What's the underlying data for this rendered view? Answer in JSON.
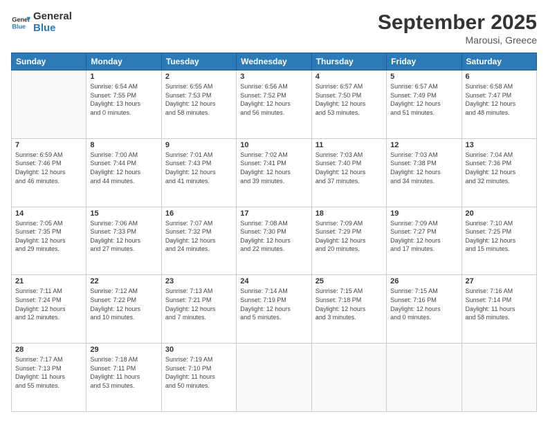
{
  "header": {
    "logo_line1": "General",
    "logo_line2": "Blue",
    "month_title": "September 2025",
    "location": "Marousi, Greece"
  },
  "weekdays": [
    "Sunday",
    "Monday",
    "Tuesday",
    "Wednesday",
    "Thursday",
    "Friday",
    "Saturday"
  ],
  "weeks": [
    [
      {
        "day": "",
        "info": ""
      },
      {
        "day": "1",
        "info": "Sunrise: 6:54 AM\nSunset: 7:55 PM\nDaylight: 13 hours\nand 0 minutes."
      },
      {
        "day": "2",
        "info": "Sunrise: 6:55 AM\nSunset: 7:53 PM\nDaylight: 12 hours\nand 58 minutes."
      },
      {
        "day": "3",
        "info": "Sunrise: 6:56 AM\nSunset: 7:52 PM\nDaylight: 12 hours\nand 56 minutes."
      },
      {
        "day": "4",
        "info": "Sunrise: 6:57 AM\nSunset: 7:50 PM\nDaylight: 12 hours\nand 53 minutes."
      },
      {
        "day": "5",
        "info": "Sunrise: 6:57 AM\nSunset: 7:49 PM\nDaylight: 12 hours\nand 51 minutes."
      },
      {
        "day": "6",
        "info": "Sunrise: 6:58 AM\nSunset: 7:47 PM\nDaylight: 12 hours\nand 48 minutes."
      }
    ],
    [
      {
        "day": "7",
        "info": "Sunrise: 6:59 AM\nSunset: 7:46 PM\nDaylight: 12 hours\nand 46 minutes."
      },
      {
        "day": "8",
        "info": "Sunrise: 7:00 AM\nSunset: 7:44 PM\nDaylight: 12 hours\nand 44 minutes."
      },
      {
        "day": "9",
        "info": "Sunrise: 7:01 AM\nSunset: 7:43 PM\nDaylight: 12 hours\nand 41 minutes."
      },
      {
        "day": "10",
        "info": "Sunrise: 7:02 AM\nSunset: 7:41 PM\nDaylight: 12 hours\nand 39 minutes."
      },
      {
        "day": "11",
        "info": "Sunrise: 7:03 AM\nSunset: 7:40 PM\nDaylight: 12 hours\nand 37 minutes."
      },
      {
        "day": "12",
        "info": "Sunrise: 7:03 AM\nSunset: 7:38 PM\nDaylight: 12 hours\nand 34 minutes."
      },
      {
        "day": "13",
        "info": "Sunrise: 7:04 AM\nSunset: 7:36 PM\nDaylight: 12 hours\nand 32 minutes."
      }
    ],
    [
      {
        "day": "14",
        "info": "Sunrise: 7:05 AM\nSunset: 7:35 PM\nDaylight: 12 hours\nand 29 minutes."
      },
      {
        "day": "15",
        "info": "Sunrise: 7:06 AM\nSunset: 7:33 PM\nDaylight: 12 hours\nand 27 minutes."
      },
      {
        "day": "16",
        "info": "Sunrise: 7:07 AM\nSunset: 7:32 PM\nDaylight: 12 hours\nand 24 minutes."
      },
      {
        "day": "17",
        "info": "Sunrise: 7:08 AM\nSunset: 7:30 PM\nDaylight: 12 hours\nand 22 minutes."
      },
      {
        "day": "18",
        "info": "Sunrise: 7:09 AM\nSunset: 7:29 PM\nDaylight: 12 hours\nand 20 minutes."
      },
      {
        "day": "19",
        "info": "Sunrise: 7:09 AM\nSunset: 7:27 PM\nDaylight: 12 hours\nand 17 minutes."
      },
      {
        "day": "20",
        "info": "Sunrise: 7:10 AM\nSunset: 7:25 PM\nDaylight: 12 hours\nand 15 minutes."
      }
    ],
    [
      {
        "day": "21",
        "info": "Sunrise: 7:11 AM\nSunset: 7:24 PM\nDaylight: 12 hours\nand 12 minutes."
      },
      {
        "day": "22",
        "info": "Sunrise: 7:12 AM\nSunset: 7:22 PM\nDaylight: 12 hours\nand 10 minutes."
      },
      {
        "day": "23",
        "info": "Sunrise: 7:13 AM\nSunset: 7:21 PM\nDaylight: 12 hours\nand 7 minutes."
      },
      {
        "day": "24",
        "info": "Sunrise: 7:14 AM\nSunset: 7:19 PM\nDaylight: 12 hours\nand 5 minutes."
      },
      {
        "day": "25",
        "info": "Sunrise: 7:15 AM\nSunset: 7:18 PM\nDaylight: 12 hours\nand 3 minutes."
      },
      {
        "day": "26",
        "info": "Sunrise: 7:15 AM\nSunset: 7:16 PM\nDaylight: 12 hours\nand 0 minutes."
      },
      {
        "day": "27",
        "info": "Sunrise: 7:16 AM\nSunset: 7:14 PM\nDaylight: 11 hours\nand 58 minutes."
      }
    ],
    [
      {
        "day": "28",
        "info": "Sunrise: 7:17 AM\nSunset: 7:13 PM\nDaylight: 11 hours\nand 55 minutes."
      },
      {
        "day": "29",
        "info": "Sunrise: 7:18 AM\nSunset: 7:11 PM\nDaylight: 11 hours\nand 53 minutes."
      },
      {
        "day": "30",
        "info": "Sunrise: 7:19 AM\nSunset: 7:10 PM\nDaylight: 11 hours\nand 50 minutes."
      },
      {
        "day": "",
        "info": ""
      },
      {
        "day": "",
        "info": ""
      },
      {
        "day": "",
        "info": ""
      },
      {
        "day": "",
        "info": ""
      }
    ]
  ]
}
